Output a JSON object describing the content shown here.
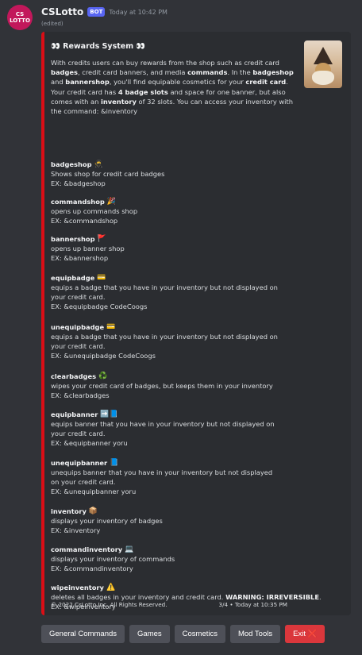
{
  "bot": {
    "avatar_text": "CS LOTTO",
    "name": "CSLotto",
    "tag": "BOT",
    "timestamp": "Today at 10:42 PM",
    "edited": "(edited)"
  },
  "embed": {
    "accent_color": "#da0e16",
    "thumbnail": "wizard-thumbnail",
    "title": "👀 Rewards System 👀",
    "description": [
      {
        "t": "With credits users can buy rewards from the shop such as credit card "
      },
      {
        "t": "badges",
        "b": true
      },
      {
        "t": ", credit card banners, and media "
      },
      {
        "t": "commands",
        "b": true
      },
      {
        "t": ". In the "
      },
      {
        "t": "badgeshop",
        "b": true
      },
      {
        "t": " and "
      },
      {
        "t": "bannershop",
        "b": true
      },
      {
        "t": ", you'll find equipable cosmetics for your "
      },
      {
        "t": "credit card",
        "b": true
      },
      {
        "t": ". Your credit card has "
      },
      {
        "t": "4 badge slots",
        "b": true
      },
      {
        "t": " and space for one banner, but also comes with an "
      },
      {
        "t": "inventory",
        "b": true
      },
      {
        "t": " of 32 slots. You can access your inventory with the command: &inventory"
      }
    ],
    "fields": [
      {
        "name": "badgeshop",
        "emoji": "🥷",
        "icon": "ninja-icon",
        "value": "Shows shop for credit card badges\nEX: &badgeshop"
      },
      {
        "name": "commandshop",
        "emoji": "🎉",
        "icon": "party-popper-icon",
        "value": "opens up commands shop\nEX: &commandshop"
      },
      {
        "name": "bannershop",
        "emoji": "🚩",
        "icon": "red-flag-icon",
        "value": "opens up banner shop\nEX: &bannershop"
      },
      {
        "name": "equipbadge",
        "emoji": "💳",
        "icon": "credit-card-icon",
        "value": "equips a badge that you have in your inventory but not displayed on\nyour credit card.\nEX: &equipbadge CodeCoogs"
      },
      {
        "name": "unequipbadge",
        "emoji": "💳",
        "icon": "credit-card-icon",
        "value": "equips a badge that you have in your inventory but not displayed on\nyour credit card.\nEX: &unequipbadge CodeCoogs"
      },
      {
        "name": "clearbadges",
        "emoji": "♻️",
        "icon": "recycle-icon",
        "value": "wipes your credit card of badges, but keeps them in your inventory\nEX: &clearbadges"
      },
      {
        "name": "equipbanner",
        "emoji": "➡️📘",
        "icon": "arrow-book-icon",
        "value": "equips banner that you have in your inventory but not displayed on\nyour credit card.\nEX: &equipbanner yoru"
      },
      {
        "name": "unequipbanner",
        "emoji": "📘",
        "icon": "book-icon",
        "value": "unequips banner that you have in your inventory but not displayed\non your credit card.\nEX: &unequipbanner yoru"
      },
      {
        "name": "inventory",
        "emoji": "📦",
        "icon": "package-icon",
        "value": "displays your inventory of badges\nEX: &inventory"
      },
      {
        "name": "commandinventory",
        "emoji": "💻",
        "icon": "laptop-icon",
        "value": "displays your inventory of commands\nEX: &commandinventory"
      },
      {
        "name": "wipeinventory",
        "emoji": "⚠️",
        "icon": "warning-icon",
        "value_parts": [
          {
            "t": "deletes all badges in your inventory and credit card. "
          },
          {
            "t": "WARNING: IRREVERSIBLE",
            "b": true
          },
          {
            "t": ".\nEX: &wipeinventory"
          }
        ]
      }
    ],
    "footer_left": "© 2022 CsLotto Inc. All Rights Reserved.",
    "footer_right": "3/4 • Today at 10:35 PM"
  },
  "buttons": [
    {
      "label": "General Commands",
      "style": "secondary"
    },
    {
      "label": "Games",
      "style": "secondary"
    },
    {
      "label": "Cosmetics",
      "style": "secondary"
    },
    {
      "label": "Mod Tools",
      "style": "secondary"
    },
    {
      "label": "Exit ❌",
      "style": "danger"
    }
  ]
}
